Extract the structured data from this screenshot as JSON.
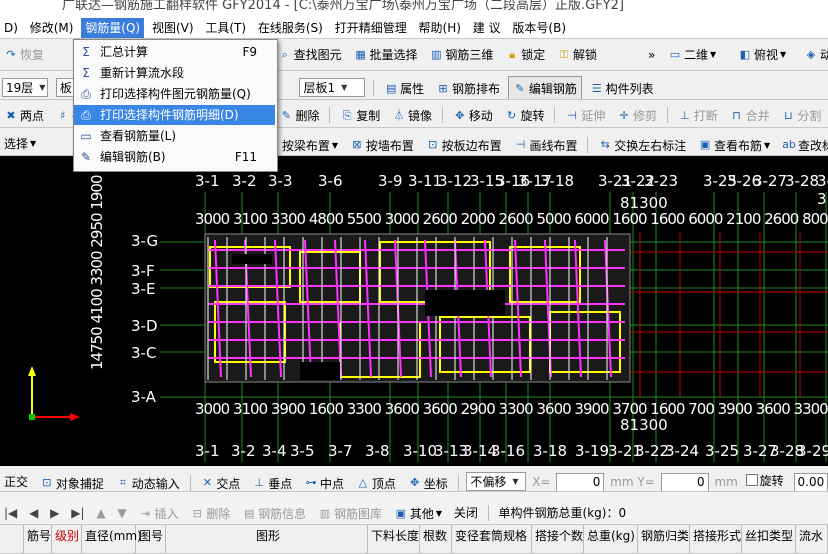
{
  "window": {
    "title": "广联达—钢筋施工翻样软件 GFY2014 - [C:\\泰州万宝广场\\泰州万宝广场（二段高层）正版.GFY2]"
  },
  "menu": [
    "D)",
    "修改(M)",
    "钢筋量(Q)",
    "视图(V)",
    "工具(T)",
    "在线服务(S)",
    "打开精细管理",
    "帮助(H)",
    "建 议",
    "版本号(B)"
  ],
  "dropdown": [
    {
      "icon": "Σ",
      "label": "汇总计算",
      "shortcut": "F9"
    },
    {
      "icon": "Σ",
      "label": "重新计算流水段",
      "shortcut": ""
    },
    {
      "icon": "⎙",
      "label": "打印选择构件图元钢筋量(Q)",
      "shortcut": ""
    },
    {
      "icon": "⎙",
      "label": "打印选择构件钢筋明细(D)",
      "shortcut": ""
    },
    {
      "icon": "▭",
      "label": "查看钢筋量(L)",
      "shortcut": ""
    },
    {
      "icon": "✎",
      "label": "编辑钢筋(B)",
      "shortcut": "F11"
    }
  ],
  "toolbar1": {
    "left": "恢复",
    "items": [
      "查找图元",
      "批量选择",
      "钢筋三维",
      "锁定",
      "解锁"
    ],
    "view": "二维",
    "view2": "俯视",
    "more": "动"
  },
  "toolbar2": {
    "floor": "19层",
    "type": "板",
    "sub": "层板1",
    "items": [
      "属性",
      "钢筋排布",
      "编辑钢筋",
      "构件列表"
    ]
  },
  "toolbar3": {
    "left": [
      "两点",
      "平"
    ],
    "items": [
      "删除",
      "复制",
      "镜像",
      "移动",
      "旋转",
      "延伸",
      "修剪",
      "打断",
      "合并",
      "分割"
    ]
  },
  "toolbar4": {
    "left": "选择",
    "items": [
      "按梁布置",
      "按墙布置",
      "按板边布置",
      "画线布置",
      "交换左右标注",
      "查看布筋",
      "查改标"
    ]
  },
  "axes_top": [
    "3-1",
    "3-2",
    "3-3",
    "3-6",
    "3-9",
    "3-11",
    "3-12",
    "3-15",
    "3-16",
    "3-17",
    "3-18",
    "3-21",
    "3-22",
    "3-23",
    "3-25",
    "3-26",
    "3-27",
    "3-28",
    "3-3"
  ],
  "dims_top": "3000 3100 3300 4800 5500 3000 2600 2000 2600 5000 6000 1600 1600 6000 2100 2600 8000 2600",
  "total_top": "81300",
  "dims_bottom": "3000 3100 3900 1600 3300 3600 3600 2900 3300 3600 3900 3700 1600 700 3900 3600 3300 2100",
  "total_bottom": "81300",
  "axes_left": [
    "3-G",
    "3-F",
    "3-E",
    "3-D",
    "3-C",
    "3-A"
  ],
  "left_dims": "14750 4100 3300 2950 1900 2600",
  "axes_bottom": [
    "3-1",
    "3-2",
    "3-4",
    "3-5",
    "3-7",
    "3-8",
    "3-10",
    "3-13",
    "3-14",
    "3-16",
    "3-18",
    "3-19",
    "3-21",
    "3-22",
    "3-24",
    "3-25",
    "3-27",
    "3-28",
    "3-29"
  ],
  "status": {
    "items": [
      "正交",
      "对象捕捉",
      "动态输入",
      "交点",
      "垂点",
      "中点",
      "顶点",
      "坐标"
    ],
    "offset": "不偏移",
    "x_label": "X=",
    "x_val": "0",
    "unit1": "mm",
    "y_label": "Y=",
    "y_val": "0",
    "unit2": "mm",
    "rotate_label": "旋转",
    "rotate_val": "0.00"
  },
  "toolrow": {
    "items": [
      "插入",
      "删除",
      "钢筋信息",
      "钢筋图库",
      "其他",
      "关闭"
    ],
    "total_label": "单构件钢筋总重(kg)：0"
  },
  "grid_headers": [
    "筋号",
    "级别",
    "直径(mm)",
    "图号",
    "图形",
    "下料长度",
    "根数",
    "变径套筒规格",
    "搭接个数",
    "总重(kg)",
    "钢筋归类",
    "搭接形式",
    "丝扣类型",
    "流水"
  ]
}
